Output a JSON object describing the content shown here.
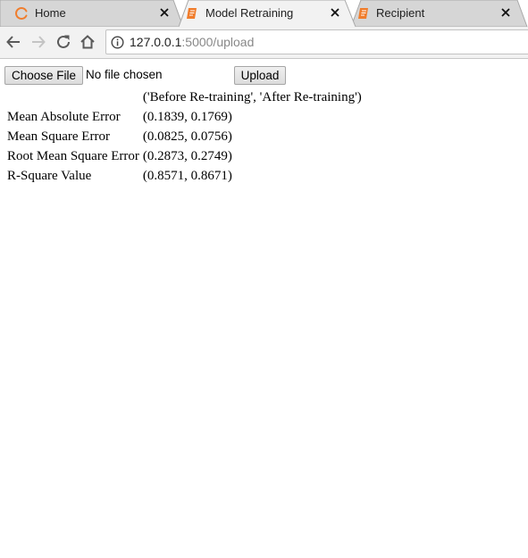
{
  "tabs": [
    {
      "title": "Home",
      "icon": "loading-spinner-icon",
      "active": false
    },
    {
      "title": "Model Retraining",
      "icon": "orange-page-icon",
      "active": true
    },
    {
      "title": "Recipient",
      "icon": "orange-page-icon",
      "active": false
    }
  ],
  "colors": {
    "accent": "#f07d2c",
    "tab_active": "#f2f2f2",
    "tab_inactive": "#d6d6d6"
  },
  "toolbar": {
    "url_host": "127.0.0.1",
    "url_path": ":5000/upload"
  },
  "form": {
    "choose_file_label": "Choose File",
    "file_status": "No file chosen",
    "upload_label": "Upload"
  },
  "results": {
    "header": "('Before Re-training', 'After Re-training')",
    "rows": [
      {
        "label": "Mean Absolute Error",
        "value": "(0.1839, 0.1769)"
      },
      {
        "label": "Mean Square Error",
        "value": "(0.0825, 0.0756)"
      },
      {
        "label": "Root Mean Square Error",
        "value": "(0.2873, 0.2749)"
      },
      {
        "label": "R-Square Value",
        "value": "(0.8571, 0.8671)"
      }
    ]
  }
}
